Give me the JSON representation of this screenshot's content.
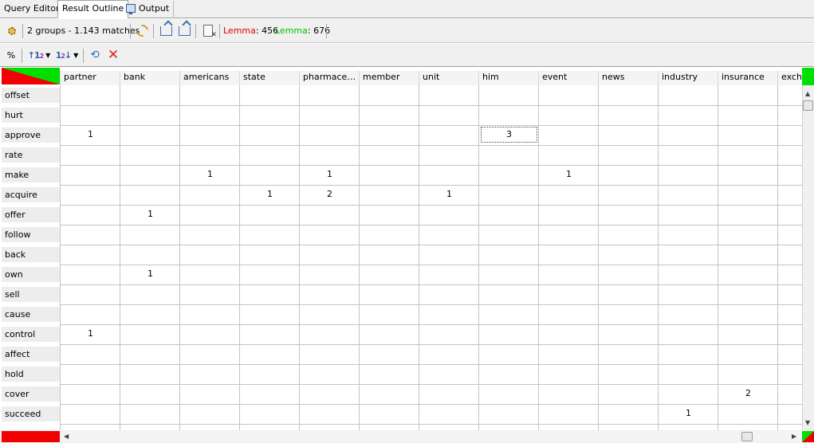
{
  "tabs": [
    "Query Editor",
    "Result Outline",
    "Output"
  ],
  "active_tab": 1,
  "toolbar": {
    "groups_text": "2 groups - 1.143 matches",
    "lemma_red_label": "Lemma",
    "lemma_red_value": ": 456",
    "lemma_green_label": "Lemma",
    "lemma_green_value": ": 676",
    "percent_label": "%"
  },
  "icons": {
    "settings": "gear-icon",
    "sync": "sync-icon",
    "export_up": "export-icon",
    "export_down": "import-icon",
    "clear": "clear-document-icon",
    "sort_asc": "sort-ascending-icon",
    "sort_desc": "sort-descending-icon",
    "refresh": "refresh-icon",
    "remove": "remove-icon"
  },
  "colors": {
    "red": "#f00000",
    "green": "#00e000",
    "grid_line": "#c4c4c4"
  },
  "grid": {
    "columns": [
      "partner",
      "bank",
      "americans",
      "state",
      "pharmaceu...",
      "member",
      "unit",
      "him",
      "event",
      "news",
      "industry",
      "insurance",
      "exch"
    ],
    "rows": [
      "offset",
      "hurt",
      "approve",
      "rate",
      "make",
      "acquire",
      "offer",
      "follow",
      "back",
      "own",
      "sell",
      "cause",
      "control",
      "affect",
      "hold",
      "cover",
      "succeed"
    ],
    "cells": [
      [
        "",
        "",
        "",
        "",
        "",
        "",
        "",
        "",
        "",
        "",
        "",
        "",
        ""
      ],
      [
        "",
        "",
        "",
        "",
        "",
        "",
        "",
        "",
        "",
        "",
        "",
        "",
        ""
      ],
      [
        "1",
        "",
        "",
        "",
        "",
        "",
        "",
        "3",
        "",
        "",
        "",
        "",
        ""
      ],
      [
        "",
        "",
        "",
        "",
        "",
        "",
        "",
        "",
        "",
        "",
        "",
        "",
        ""
      ],
      [
        "",
        "",
        "1",
        "",
        "1",
        "",
        "",
        "",
        "1",
        "",
        "",
        "",
        ""
      ],
      [
        "",
        "",
        "",
        "1",
        "2",
        "",
        "1",
        "",
        "",
        "",
        "",
        "",
        ""
      ],
      [
        "",
        "1",
        "",
        "",
        "",
        "",
        "",
        "",
        "",
        "",
        "",
        "",
        ""
      ],
      [
        "",
        "",
        "",
        "",
        "",
        "",
        "",
        "",
        "",
        "",
        "",
        "",
        ""
      ],
      [
        "",
        "",
        "",
        "",
        "",
        "",
        "",
        "",
        "",
        "",
        "",
        "",
        ""
      ],
      [
        "",
        "1",
        "",
        "",
        "",
        "",
        "",
        "",
        "",
        "",
        "",
        "",
        ""
      ],
      [
        "",
        "",
        "",
        "",
        "",
        "",
        "",
        "",
        "",
        "",
        "",
        "",
        ""
      ],
      [
        "",
        "",
        "",
        "",
        "",
        "",
        "",
        "",
        "",
        "",
        "",
        "",
        ""
      ],
      [
        "1",
        "",
        "",
        "",
        "",
        "",
        "",
        "",
        "",
        "",
        "",
        "",
        ""
      ],
      [
        "",
        "",
        "",
        "",
        "",
        "",
        "",
        "",
        "",
        "",
        "",
        "",
        ""
      ],
      [
        "",
        "",
        "",
        "",
        "",
        "",
        "",
        "",
        "",
        "",
        "",
        "",
        ""
      ],
      [
        "",
        "",
        "",
        "",
        "",
        "",
        "",
        "",
        "",
        "",
        "",
        "2",
        ""
      ],
      [
        "",
        "",
        "",
        "",
        "",
        "",
        "",
        "",
        "",
        "",
        "1",
        "",
        ""
      ]
    ],
    "selected_cell": {
      "row": 2,
      "col": 7
    }
  }
}
